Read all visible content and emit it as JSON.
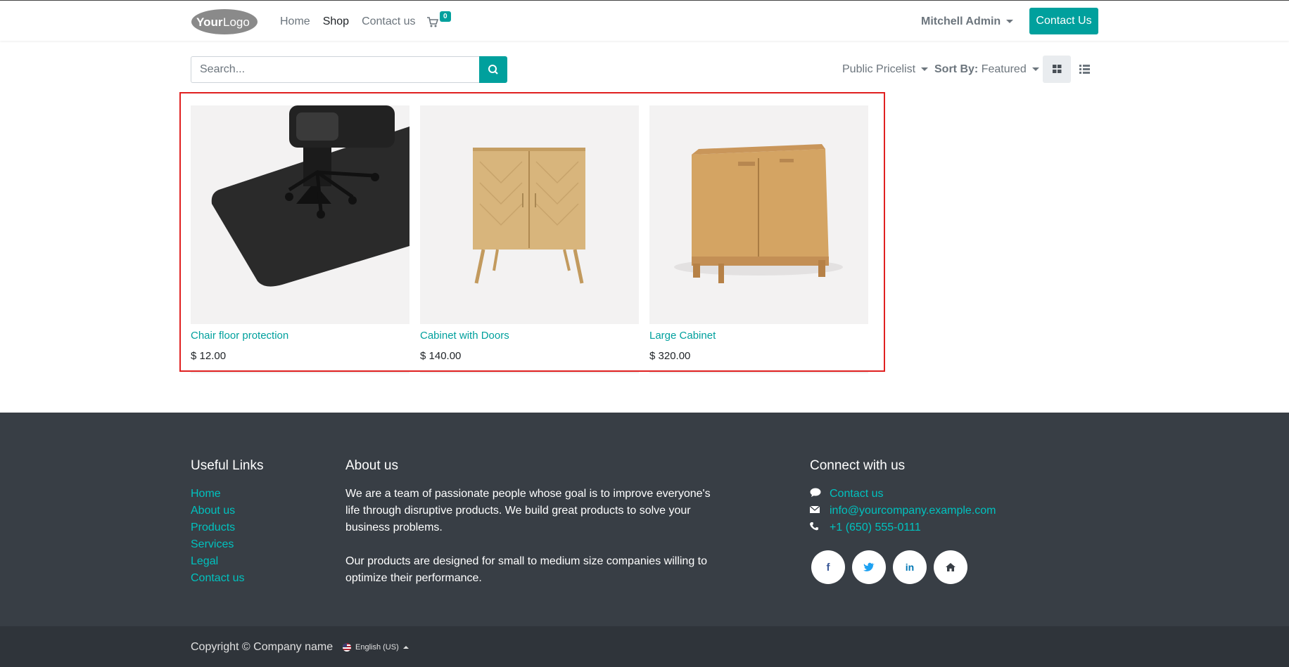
{
  "header": {
    "nav": [
      {
        "label": "Home",
        "active": false
      },
      {
        "label": "Shop",
        "active": true
      },
      {
        "label": "Contact us",
        "active": false
      }
    ],
    "cart_count": "0",
    "user": "Mitchell Admin",
    "contact_button": "Contact Us",
    "accent": "#00a09d"
  },
  "toolbar": {
    "search_placeholder": "Search...",
    "pricelist": "Public Pricelist",
    "sort_label": "Sort By:",
    "sort_value": "Featured"
  },
  "products": [
    {
      "name": "Chair floor protection",
      "price": "$ 12.00"
    },
    {
      "name": "Cabinet with Doors",
      "price": "$ 140.00"
    },
    {
      "name": "Large Cabinet",
      "price": "$ 320.00"
    }
  ],
  "footer": {
    "useful_links_title": "Useful Links",
    "useful_links": [
      "Home",
      "About us",
      "Products",
      "Services",
      "Legal",
      "Contact us"
    ],
    "about_title": "About us",
    "about_p1": "We are a team of passionate people whose goal is to improve everyone's life through disruptive products. We build great products to solve your business problems.",
    "about_p2": "Our products are designed for small to medium size companies willing to optimize their performance.",
    "connect_title": "Connect with us",
    "connect_contact": "Contact us",
    "connect_email": "info@yourcompany.example.com",
    "connect_phone": "+1 (650) 555-0111",
    "social": [
      "facebook-icon",
      "twitter-icon",
      "linkedin-icon",
      "home-icon"
    ]
  },
  "copyright": {
    "text": "Copyright © Company name",
    "language": "English (US)"
  }
}
